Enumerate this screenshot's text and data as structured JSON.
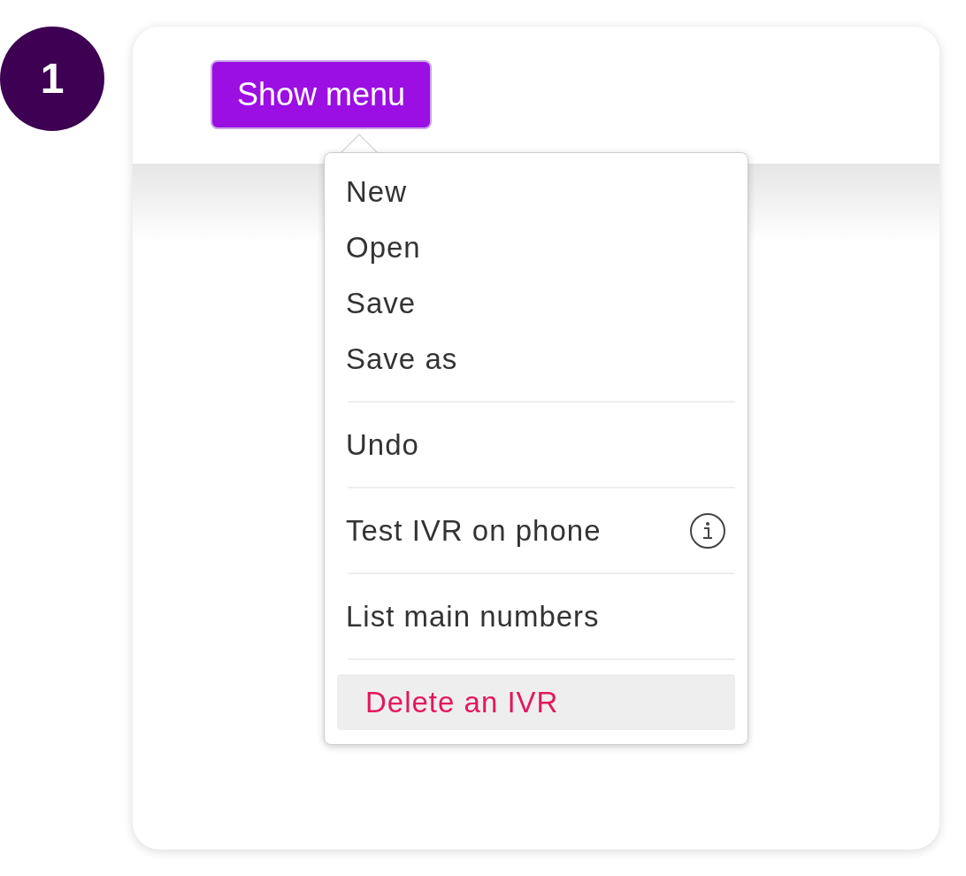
{
  "step": "1",
  "button": {
    "label": "Show menu"
  },
  "menu": {
    "groups": [
      {
        "items": [
          {
            "label": "New",
            "kind": "normal",
            "info": false,
            "selected": false
          },
          {
            "label": "Open",
            "kind": "normal",
            "info": false,
            "selected": false
          },
          {
            "label": "Save",
            "kind": "normal",
            "info": false,
            "selected": false
          },
          {
            "label": "Save as",
            "kind": "normal",
            "info": false,
            "selected": false
          }
        ]
      },
      {
        "items": [
          {
            "label": "Undo",
            "kind": "normal",
            "info": false,
            "selected": false
          }
        ]
      },
      {
        "items": [
          {
            "label": "Test IVR on phone",
            "kind": "normal",
            "info": true,
            "selected": false
          }
        ]
      },
      {
        "items": [
          {
            "label": "List main numbers",
            "kind": "normal",
            "info": false,
            "selected": false
          }
        ]
      },
      {
        "items": [
          {
            "label": "Delete an IVR",
            "kind": "destructive",
            "info": false,
            "selected": true
          }
        ]
      }
    ]
  }
}
